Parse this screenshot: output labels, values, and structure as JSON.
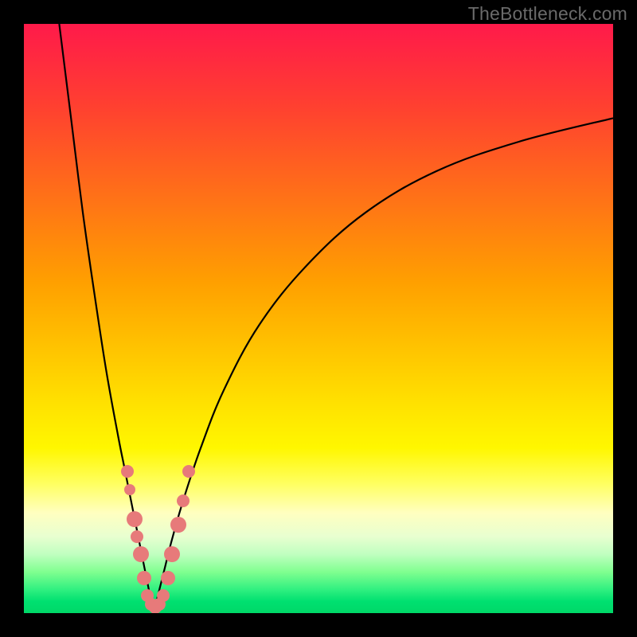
{
  "watermark": "TheBottleneck.com",
  "colors": {
    "frame": "#000000",
    "curve": "#000000",
    "marker": "#e77a7a",
    "gradient_top": "#ff1a4a",
    "gradient_bottom": "#00d868"
  },
  "chart_data": {
    "type": "line",
    "title": "",
    "xlabel": "",
    "ylabel": "",
    "xlim": [
      0,
      100
    ],
    "ylim": [
      0,
      100
    ],
    "x_notch": 22,
    "series": [
      {
        "name": "left-branch",
        "x": [
          6,
          8,
          10,
          12,
          14,
          16,
          17,
          18,
          19,
          20,
          21,
          22
        ],
        "y": [
          100,
          84,
          68,
          54,
          41,
          30,
          25,
          20,
          15,
          10,
          5,
          0
        ]
      },
      {
        "name": "right-branch",
        "x": [
          22,
          23,
          24,
          25,
          27,
          30,
          34,
          40,
          48,
          58,
          70,
          84,
          100
        ],
        "y": [
          0,
          4,
          8,
          12,
          19,
          28,
          38,
          49,
          59,
          68,
          75,
          80,
          84
        ]
      }
    ],
    "markers": {
      "name": "data-points",
      "points": [
        {
          "x": 17.5,
          "y": 24,
          "r": 8
        },
        {
          "x": 18.0,
          "y": 21,
          "r": 7
        },
        {
          "x": 18.8,
          "y": 16,
          "r": 10
        },
        {
          "x": 19.2,
          "y": 13,
          "r": 8
        },
        {
          "x": 19.8,
          "y": 10,
          "r": 10
        },
        {
          "x": 20.4,
          "y": 6,
          "r": 9
        },
        {
          "x": 21.0,
          "y": 3,
          "r": 8
        },
        {
          "x": 21.6,
          "y": 1.5,
          "r": 8
        },
        {
          "x": 22.3,
          "y": 1,
          "r": 8
        },
        {
          "x": 23.0,
          "y": 1.5,
          "r": 8
        },
        {
          "x": 23.7,
          "y": 3,
          "r": 8
        },
        {
          "x": 24.4,
          "y": 6,
          "r": 9
        },
        {
          "x": 25.2,
          "y": 10,
          "r": 10
        },
        {
          "x": 26.2,
          "y": 15,
          "r": 10
        },
        {
          "x": 27.0,
          "y": 19,
          "r": 8
        },
        {
          "x": 28.0,
          "y": 24,
          "r": 8
        }
      ]
    }
  }
}
